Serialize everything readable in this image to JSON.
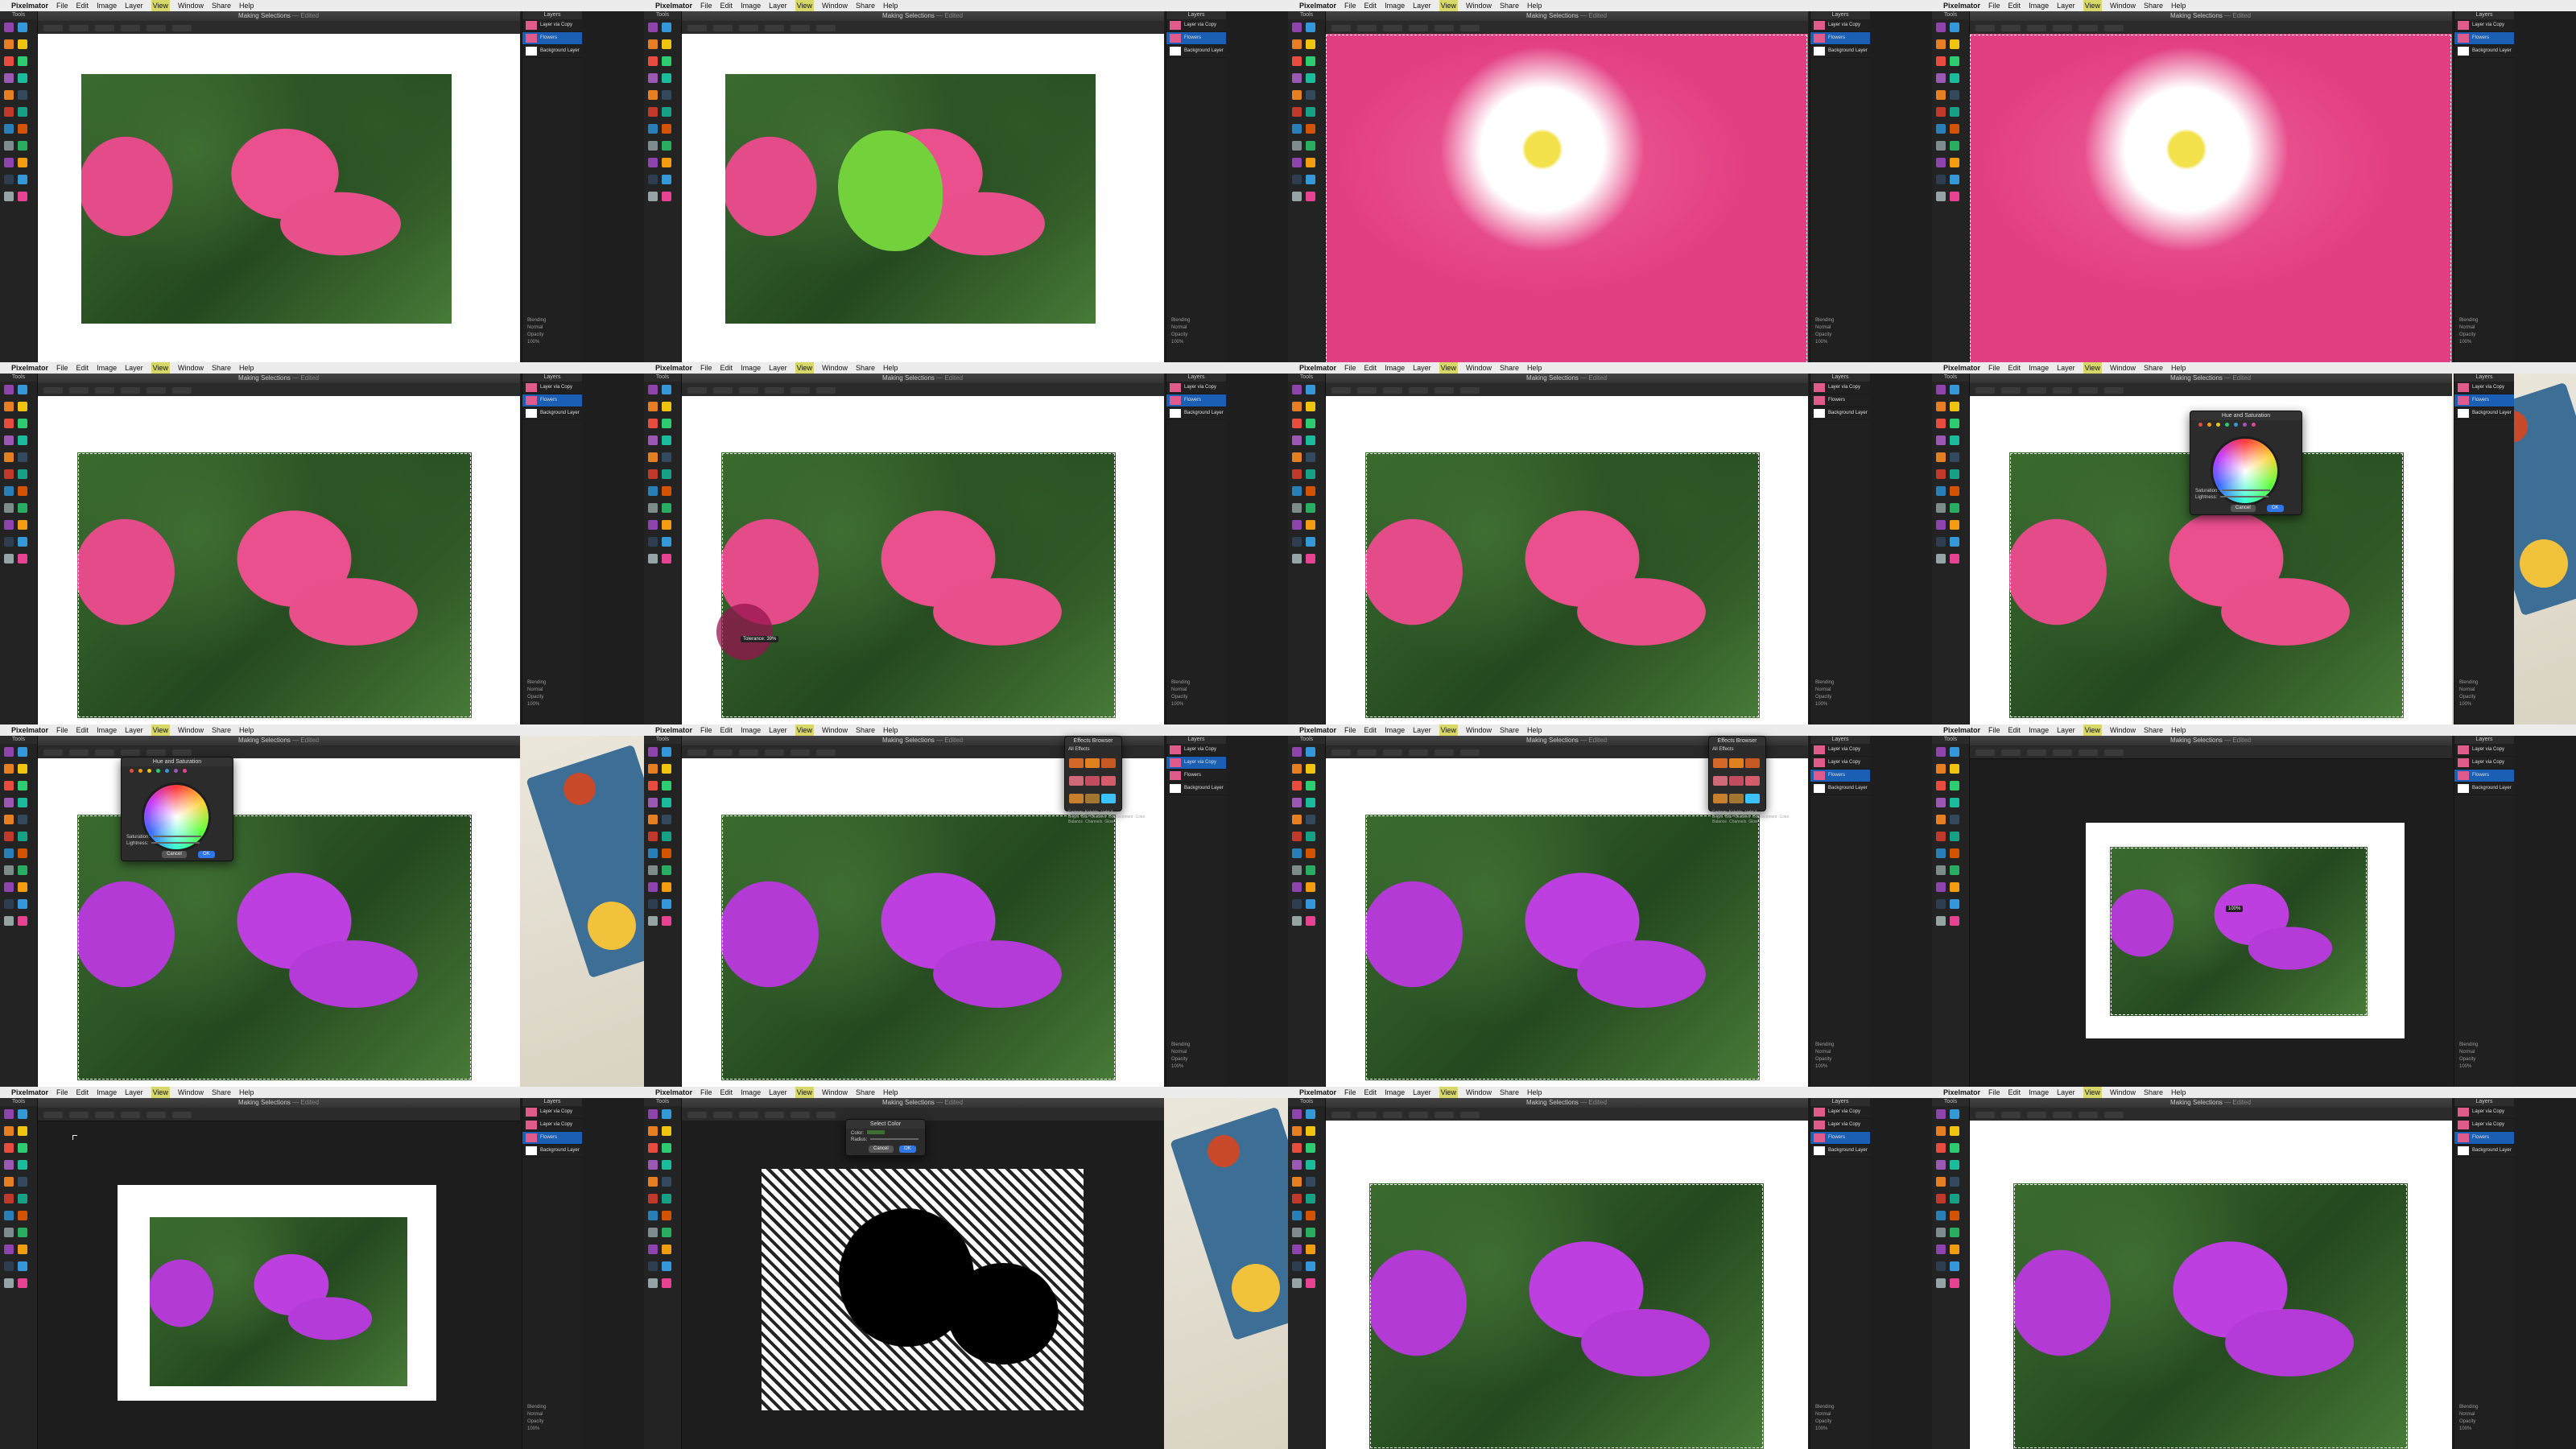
{
  "menu": {
    "apple": "",
    "app": "Pixelmator",
    "items": [
      "File",
      "Edit",
      "Image",
      "Layer",
      "View",
      "Window",
      "Share",
      "Help"
    ]
  },
  "tools_title": "Tools",
  "window": {
    "title": "Making Selections",
    "suffix": "— Edited"
  },
  "layers": {
    "title": "Layers",
    "layer_via_copy": "Layer via Copy",
    "flowers": "Flowers",
    "background": "Background Layer",
    "blending": "Blending",
    "blend_mode": "Normal",
    "opacity": "Opacity",
    "opacity_value": "100%"
  },
  "hue_saturation": {
    "title": "Hue and Saturation",
    "saturation": "Saturation:",
    "lightness": "Lightness:",
    "cancel": "Cancel",
    "ok": "OK"
  },
  "effects": {
    "title": "Effects Browser",
    "category": "All Effects",
    "labels": [
      "Cartoon",
      "Kaleido",
      "Light & Bright",
      "Blur",
      "Gradient",
      "Displacement",
      "Color Balance",
      "Channels",
      "Glow"
    ]
  },
  "select_color": {
    "title": "Select Color",
    "color": "Color:",
    "radius": "Radius:",
    "cancel": "Cancel",
    "ok": "OK"
  },
  "tooltip_tolerance": "Tolerance: 39%",
  "tooltip_opacity": "100%",
  "colors": {
    "pink": "#e24e8a",
    "purple": "#b83ddb",
    "accent": "#1a5fb4",
    "ok_button": "#2f77e6",
    "leaf_green": "#3a6b2f",
    "green_fill": "#73d13c"
  }
}
